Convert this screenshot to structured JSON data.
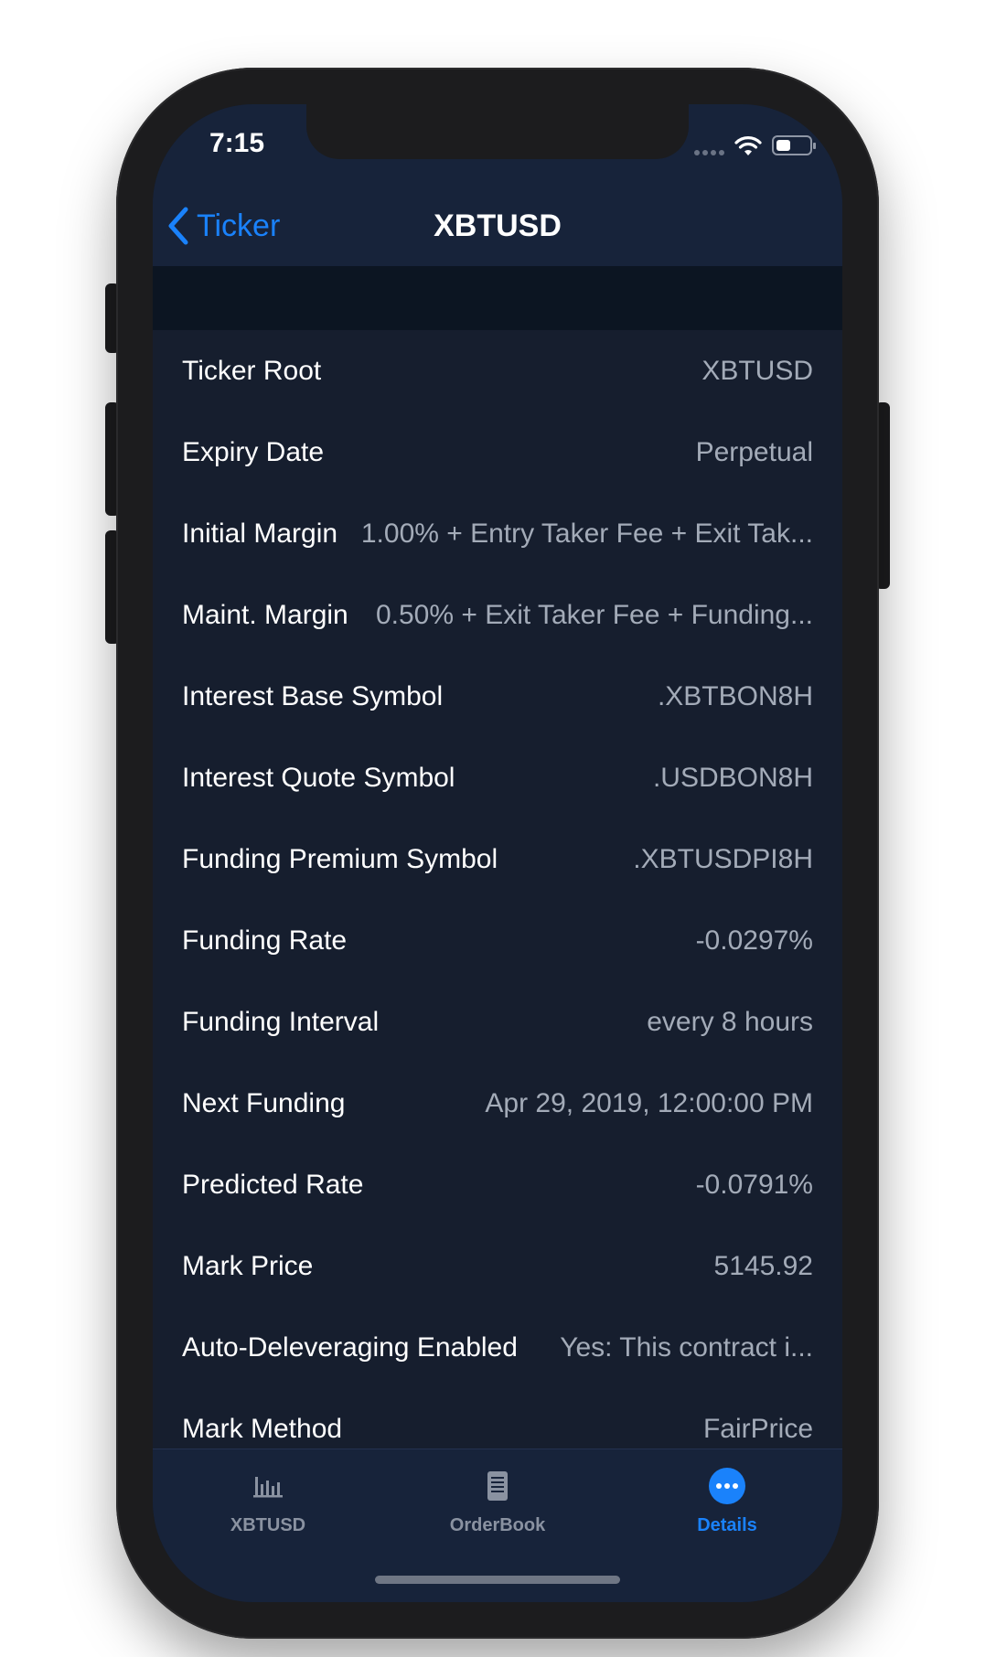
{
  "status_bar": {
    "time": "7:15",
    "battery_level": 0.45
  },
  "nav": {
    "back_label": "Ticker",
    "title": "XBTUSD"
  },
  "details": [
    {
      "key": "Ticker Root",
      "value": "XBTUSD"
    },
    {
      "key": "Expiry Date",
      "value": "Perpetual"
    },
    {
      "key": "Initial Margin",
      "value": "1.00% + Entry Taker Fee + Exit Tak..."
    },
    {
      "key": "Maint. Margin",
      "value": "0.50% + Exit Taker Fee + Funding..."
    },
    {
      "key": "Interest Base Symbol",
      "value": ".XBTBON8H"
    },
    {
      "key": "Interest Quote Symbol",
      "value": ".USDBON8H"
    },
    {
      "key": "Funding Premium Symbol",
      "value": ".XBTUSDPI8H"
    },
    {
      "key": "Funding Rate",
      "value": "-0.0297%"
    },
    {
      "key": "Funding Interval",
      "value": "every 8 hours"
    },
    {
      "key": "Next Funding",
      "value": "Apr 29, 2019, 12:00:00 PM"
    },
    {
      "key": "Predicted Rate",
      "value": "-0.0791%"
    },
    {
      "key": "Mark Price",
      "value": "5145.92"
    },
    {
      "key": "Auto-Deleveraging Enabled",
      "value": "Yes: This contract i..."
    },
    {
      "key": "Mark Method",
      "value": "FairPrice"
    }
  ],
  "tabs": [
    {
      "label": "XBTUSD",
      "icon": "bar-chart-icon",
      "active": false
    },
    {
      "label": "OrderBook",
      "icon": "document-icon",
      "active": false
    },
    {
      "label": "Details",
      "icon": "more-icon",
      "active": true
    }
  ],
  "colors": {
    "accent": "#1a82fb",
    "header_bg": "#17233a",
    "list_bg": "#161e2e",
    "section_band": "#0c1522",
    "value_text": "#a3abb8",
    "inactive_tab": "#8a92a1"
  }
}
